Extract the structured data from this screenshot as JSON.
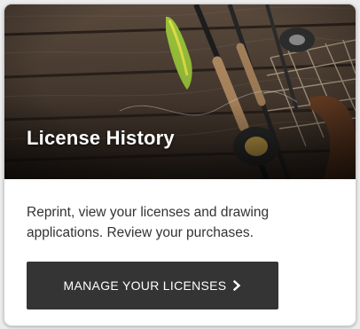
{
  "card": {
    "title": "License History",
    "description": "Reprint, view your licenses and drawing applications. Review your purchases.",
    "button": {
      "label": "MANAGE YOUR LICENSES",
      "icon": "chevron-right-icon"
    },
    "hero_image": "fishing-rods-and-lure-on-wooden-dock"
  },
  "colors": {
    "button_bg": "#343434",
    "button_text": "#ffffff",
    "body_text": "#333333",
    "title_text": "#ffffff"
  }
}
